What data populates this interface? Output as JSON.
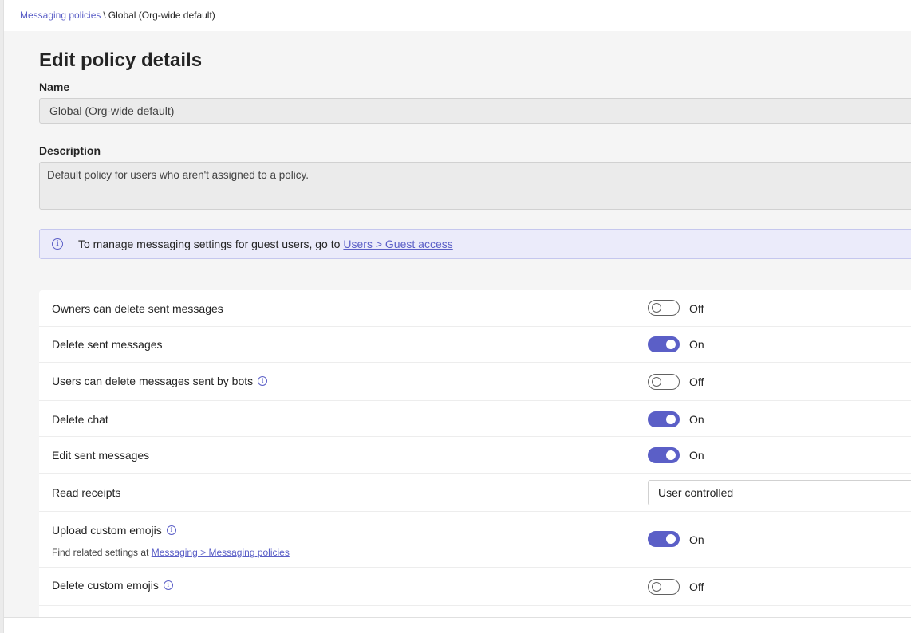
{
  "breadcrumb": {
    "parent": "Messaging policies",
    "separator": "\\",
    "current": "Global (Org-wide default)"
  },
  "page_title": "Edit policy details",
  "name_field": {
    "label": "Name",
    "value": "Global (Org-wide default)"
  },
  "description_field": {
    "label": "Description",
    "value": "Default policy for users who aren't assigned to a policy."
  },
  "info_banner": {
    "text": "To manage messaging settings for guest users, go to",
    "link": "Users > Guest access"
  },
  "settings": [
    {
      "label": "Owners can delete sent messages",
      "state": "Off",
      "info": false
    },
    {
      "label": "Delete sent messages",
      "state": "On",
      "info": false
    },
    {
      "label": "Users can delete messages sent by bots",
      "state": "Off",
      "info": true
    },
    {
      "label": "Delete chat",
      "state": "On",
      "info": false
    },
    {
      "label": "Edit sent messages",
      "state": "On",
      "info": false
    },
    {
      "label": "Read receipts",
      "select_value": "User controlled",
      "info": false
    },
    {
      "label": "Upload custom emojis",
      "state": "On",
      "info": true,
      "note": "Find related settings at",
      "note_link": "Messaging > Messaging policies"
    },
    {
      "label": "Delete custom emojis",
      "state": "Off",
      "info": true
    }
  ],
  "colors": {
    "accent": "#5b5fc7",
    "banner_bg": "#ebebfa"
  },
  "icons": {
    "info": "info-circle-icon"
  }
}
